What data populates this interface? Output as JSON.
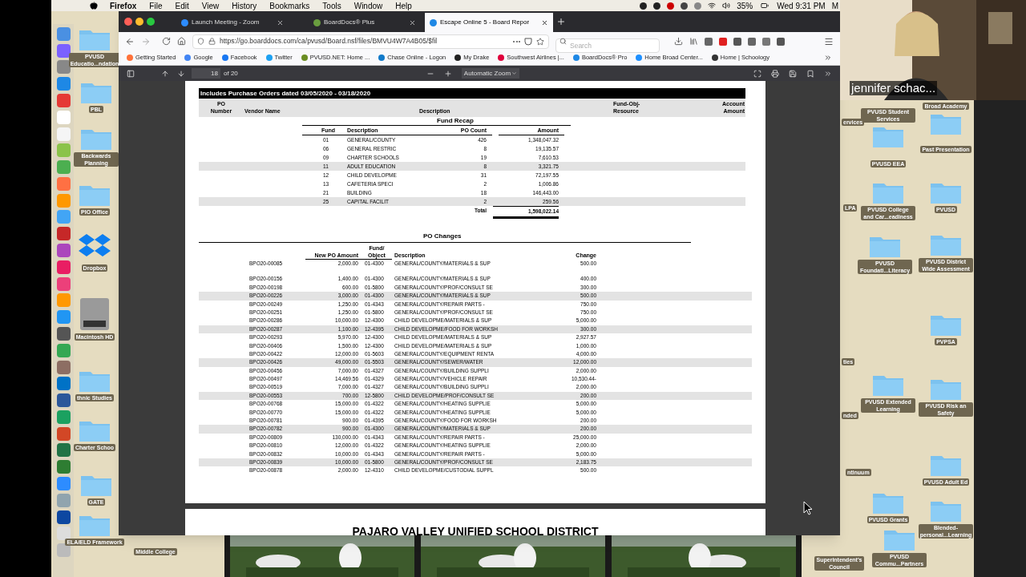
{
  "menu_bar": {
    "app": "Firefox",
    "menus": [
      "File",
      "Edit",
      "View",
      "History",
      "Bookmarks",
      "Tools",
      "Window",
      "Help"
    ],
    "battery": "35%",
    "clock": "Wed 9:31 PM",
    "cut_item": "M"
  },
  "desktop_left": [
    "PVUSD Educatio...ndation",
    "PBL",
    "Backwards Planning",
    "PIO Office",
    "Dropbox",
    "Macintosh HD",
    "thnic Studies",
    "Charter Schoo",
    "GATE",
    "ELA/ELD Framework",
    "Middle College"
  ],
  "desktop_right": [
    "PVUSD Student Services",
    "Broad Academy",
    "Past Presentation",
    "PVUSD EEA",
    "PVUSD College and Car...eadiness",
    "PVUSD",
    "PVUSD Foundati...Literacy",
    "PVUSD District Wide Assessment",
    "PVPSA",
    "PVUSD Extended Learning",
    "PVUSD Risk an Safety",
    "PVUSD Adult Ed",
    "PVUSD Grants",
    "Blended-personal...Learning",
    "PVUSD Commu...Partners"
  ],
  "desktop_partial": [
    "ervices",
    "LPA",
    "ties",
    "nded",
    "ntinuum",
    "Superintendent's Council"
  ],
  "browser": {
    "tabs": [
      {
        "title": "Launch Meeting - Zoom",
        "selected": false
      },
      {
        "title": "BoardDocs® Plus",
        "selected": false
      },
      {
        "title": "Escape Online 5 - Board Repor",
        "selected": true
      }
    ],
    "url": "https://go.boarddocs.com/ca/pvusd/Board.nsf/files/BMVU4W7A4B05/$fil",
    "search_placeholder": "Search",
    "bookmarks": [
      "Getting Started",
      "Google",
      "Facebook",
      "Twitter",
      "PVUSD.NET: Home ...",
      "Chase Online - Logon",
      "My Drake",
      "Southwest Airlines |...",
      "BoardDocs® Pro",
      "Home Broad Center...",
      "Home | Schoology"
    ],
    "pdf_toolbar": {
      "page": "18",
      "page_count": "of 20",
      "zoom": "Automatic Zoom"
    }
  },
  "document": {
    "banner": "Includes Purchase Orders dated 03/05/2020 - 03/18/2020",
    "header": {
      "po_number": "PO Number",
      "vendor": "Vendor Name",
      "description": "Description",
      "fund_obj": "Fund-Obj-Resource",
      "account": "Account Amount"
    },
    "fund_recap": {
      "title": "Fund Recap",
      "columns": [
        "Fund",
        "Description",
        "PO Count",
        "Amount"
      ],
      "rows": [
        {
          "fund": "01",
          "description": "GENERAL/COUNTY",
          "count": "426",
          "amount": "1,348,047.32",
          "shaded": false
        },
        {
          "fund": "06",
          "description": "GENERAL RESTRIC",
          "count": "8",
          "amount": "19,135.57",
          "shaded": false
        },
        {
          "fund": "09",
          "description": "CHARTER SCHOOLS",
          "count": "19",
          "amount": "7,610.53",
          "shaded": false
        },
        {
          "fund": "11",
          "description": "ADULT EDUCATION",
          "count": "8",
          "amount": "3,321.75",
          "shaded": true
        },
        {
          "fund": "12",
          "description": "CHILD DEVELOPME",
          "count": "31",
          "amount": "72,197.55",
          "shaded": false
        },
        {
          "fund": "13",
          "description": "CAFETERIA SPECI",
          "count": "2",
          "amount": "1,006.86",
          "shaded": false
        },
        {
          "fund": "21",
          "description": "BUILDING",
          "count": "18",
          "amount": "146,443.00",
          "shaded": false
        },
        {
          "fund": "25",
          "description": "CAPITAL FACILIT",
          "count": "2",
          "amount": "259.56",
          "shaded": true
        }
      ],
      "total_label": "Total",
      "total": "1,598,022.14"
    },
    "po_changes": {
      "title": "PO Changes",
      "columns": [
        "New PO Amount",
        "Fund/ Object",
        "Description",
        "Change"
      ],
      "rows": [
        {
          "po": "BPO20-00085",
          "amount": "2,000.00",
          "fund": "01-4300",
          "description": "GENERAL/COUNTY/MATERIALS & SUP",
          "change": "500.00",
          "shaded": false
        },
        {
          "po": "BPO20-00156",
          "amount": "1,400.00",
          "fund": "01-4300",
          "description": "GENERAL/COUNTY/MATERIALS & SUP",
          "change": "400.00",
          "shaded": false
        },
        {
          "po": "BPO20-00198",
          "amount": "600.00",
          "fund": "01-5800",
          "description": "GENERAL/COUNTY/PROF/CONSULT SE",
          "change": "300.00",
          "shaded": false
        },
        {
          "po": "BPO20-00226",
          "amount": "3,000.00",
          "fund": "01-4300",
          "description": "GENERAL/COUNTY/MATERIALS & SUP",
          "change": "500.00",
          "shaded": true
        },
        {
          "po": "BPO20-00249",
          "amount": "1,250.00",
          "fund": "01-4343",
          "description": "GENERAL/COUNTY/REPAIR PARTS -",
          "change": "750.00",
          "shaded": false
        },
        {
          "po": "BPO20-00251",
          "amount": "1,250.00",
          "fund": "01-5800",
          "description": "GENERAL/COUNTY/PROF/CONSULT SE",
          "change": "750.00",
          "shaded": false
        },
        {
          "po": "BPO20-00286",
          "amount": "10,000.00",
          "fund": "12-4300",
          "description": "CHILD DEVELOPME/MATERIALS & SUP",
          "change": "5,000.00",
          "shaded": false
        },
        {
          "po": "BPO20-00287",
          "amount": "1,100.00",
          "fund": "12-4395",
          "description": "CHILD DEVELOPME/FOOD FOR WORKSH",
          "change": "300.00",
          "shaded": true
        },
        {
          "po": "BPO20-00293",
          "amount": "5,970.00",
          "fund": "12-4300",
          "description": "CHILD DEVELOPME/MATERIALS & SUP",
          "change": "2,927.57",
          "shaded": false
        },
        {
          "po": "BPO20-00406",
          "amount": "1,500.00",
          "fund": "12-4300",
          "description": "CHILD DEVELOPME/MATERIALS & SUP",
          "change": "1,000.00",
          "shaded": false
        },
        {
          "po": "BPO20-00422",
          "amount": "12,000.00",
          "fund": "01-5603",
          "description": "GENERAL/COUNTY/EQUIPMENT RENTA",
          "change": "4,000.00",
          "shaded": false
        },
        {
          "po": "BPO20-00426",
          "amount": "49,000.00",
          "fund": "01-5503",
          "description": "GENERAL/COUNTY/SEWER/WATER",
          "change": "12,000.00",
          "shaded": true
        },
        {
          "po": "BPO20-00456",
          "amount": "7,000.00",
          "fund": "01-4327",
          "description": "GENERAL/COUNTY/BUILDING SUPPLI",
          "change": "2,000.00",
          "shaded": false
        },
        {
          "po": "BPO20-00497",
          "amount": "14,469.56",
          "fund": "01-4329",
          "description": "GENERAL/COUNTY/VEHICLE REPAIR",
          "change": "10,530.44-",
          "shaded": false
        },
        {
          "po": "BPO20-00519",
          "amount": "7,000.00",
          "fund": "01-4327",
          "description": "GENERAL/COUNTY/BUILDING SUPPLI",
          "change": "2,000.00",
          "shaded": false
        },
        {
          "po": "BPO20-00553",
          "amount": "700.00",
          "fund": "12-5800",
          "description": "CHILD DEVELOPME/PROF/CONSULT SE",
          "change": "200.00",
          "shaded": true
        },
        {
          "po": "BPO20-00768",
          "amount": "15,000.00",
          "fund": "01-4322",
          "description": "GENERAL/COUNTY/HEATING SUPPLIE",
          "change": "5,000.00",
          "shaded": false
        },
        {
          "po": "BPO20-00770",
          "amount": "15,000.00",
          "fund": "01-4322",
          "description": "GENERAL/COUNTY/HEATING SUPPLIE",
          "change": "5,000.00",
          "shaded": false
        },
        {
          "po": "BPO20-00781",
          "amount": "900.00",
          "fund": "01-4395",
          "description": "GENERAL/COUNTY/FOOD FOR WORKSH",
          "change": "200.00",
          "shaded": false
        },
        {
          "po": "BPO20-00782",
          "amount": "900.00",
          "fund": "01-4300",
          "description": "GENERAL/COUNTY/MATERIALS & SUP",
          "change": "200.00",
          "shaded": true
        },
        {
          "po": "BPO20-00809",
          "amount": "130,000.00",
          "fund": "01-4343",
          "description": "GENERAL/COUNTY/REPAIR PARTS -",
          "change": "25,000.00",
          "shaded": false
        },
        {
          "po": "BPO20-00810",
          "amount": "12,000.00",
          "fund": "01-4322",
          "description": "GENERAL/COUNTY/HEATING SUPPLIE",
          "change": "2,000.00",
          "shaded": false
        },
        {
          "po": "BPO20-00832",
          "amount": "10,000.00",
          "fund": "01-4343",
          "description": "GENERAL/COUNTY/REPAIR PARTS -",
          "change": "5,000.00",
          "shaded": false
        },
        {
          "po": "BPO20-00839",
          "amount": "10,000.00",
          "fund": "01-5800",
          "description": "GENERAL/COUNTY/PROF/CONSULT SE",
          "change": "2,183.75",
          "shaded": true
        },
        {
          "po": "BPO20-00878",
          "amount": "2,000.00",
          "fund": "12-4310",
          "description": "CHILD DEVELOPME/CUSTODIAL SUPPL",
          "change": "500.00",
          "shaded": false
        }
      ]
    },
    "next_page_title": "PAJARO VALLEY UNIFIED SCHOOL DISTRICT"
  },
  "video": {
    "participant": "jennifer schac..."
  }
}
